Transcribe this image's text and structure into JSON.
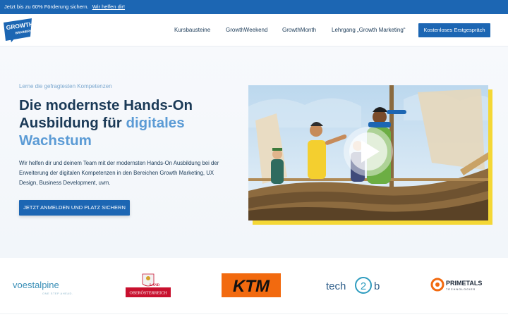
{
  "promo": {
    "text": "Jetzt bis zu 60% Förderung sichern.",
    "link": "Wir helfen dir!"
  },
  "header": {
    "logo_text_top": "GROWTH",
    "logo_text_bottom": "BRAINERY",
    "nav": [
      "Kursbausteine",
      "GrowthWeekend",
      "GrowthMonth",
      "Lehrgang „Growth Marketing“"
    ],
    "cta": "Kostenloses Erstgespräch"
  },
  "hero": {
    "eyebrow": "Lerne die gefragtesten Kompetenzen",
    "headline_main": "Die modernste Hands-On Ausbildung für ",
    "headline_accent": "digitales Wachstum",
    "description": "Wir helfen dir und deinem Team mit der modernsten Hands-On Ausbildung bei der Erweiterung der digitalen Kompetenzen in den Bereichen Growth Marketing, UX Design, Business Development, uvm.",
    "cta": "JETZT ANMELDEN UND PLATZ SICHERN",
    "video_icon": "play-icon"
  },
  "logos": {
    "voestalpine": "voestalpine",
    "voestalpine_tag": "ONE STEP AHEAD.",
    "land": "LAND",
    "oberoesterreich": "OBERÖSTERREICH",
    "ktm": "KTM",
    "tech2b_left": "tech",
    "tech2b_mid": "2",
    "tech2b_right": "b",
    "primetals": "PRIMETALS",
    "primetals_sub": "TECHNOLOGIES"
  },
  "colors": {
    "brand_blue": "#1c66b3",
    "accent_blue": "#5b9bd5",
    "yellow": "#f4d735",
    "ktm_orange": "#f26a0f",
    "land_red": "#c8102e"
  }
}
